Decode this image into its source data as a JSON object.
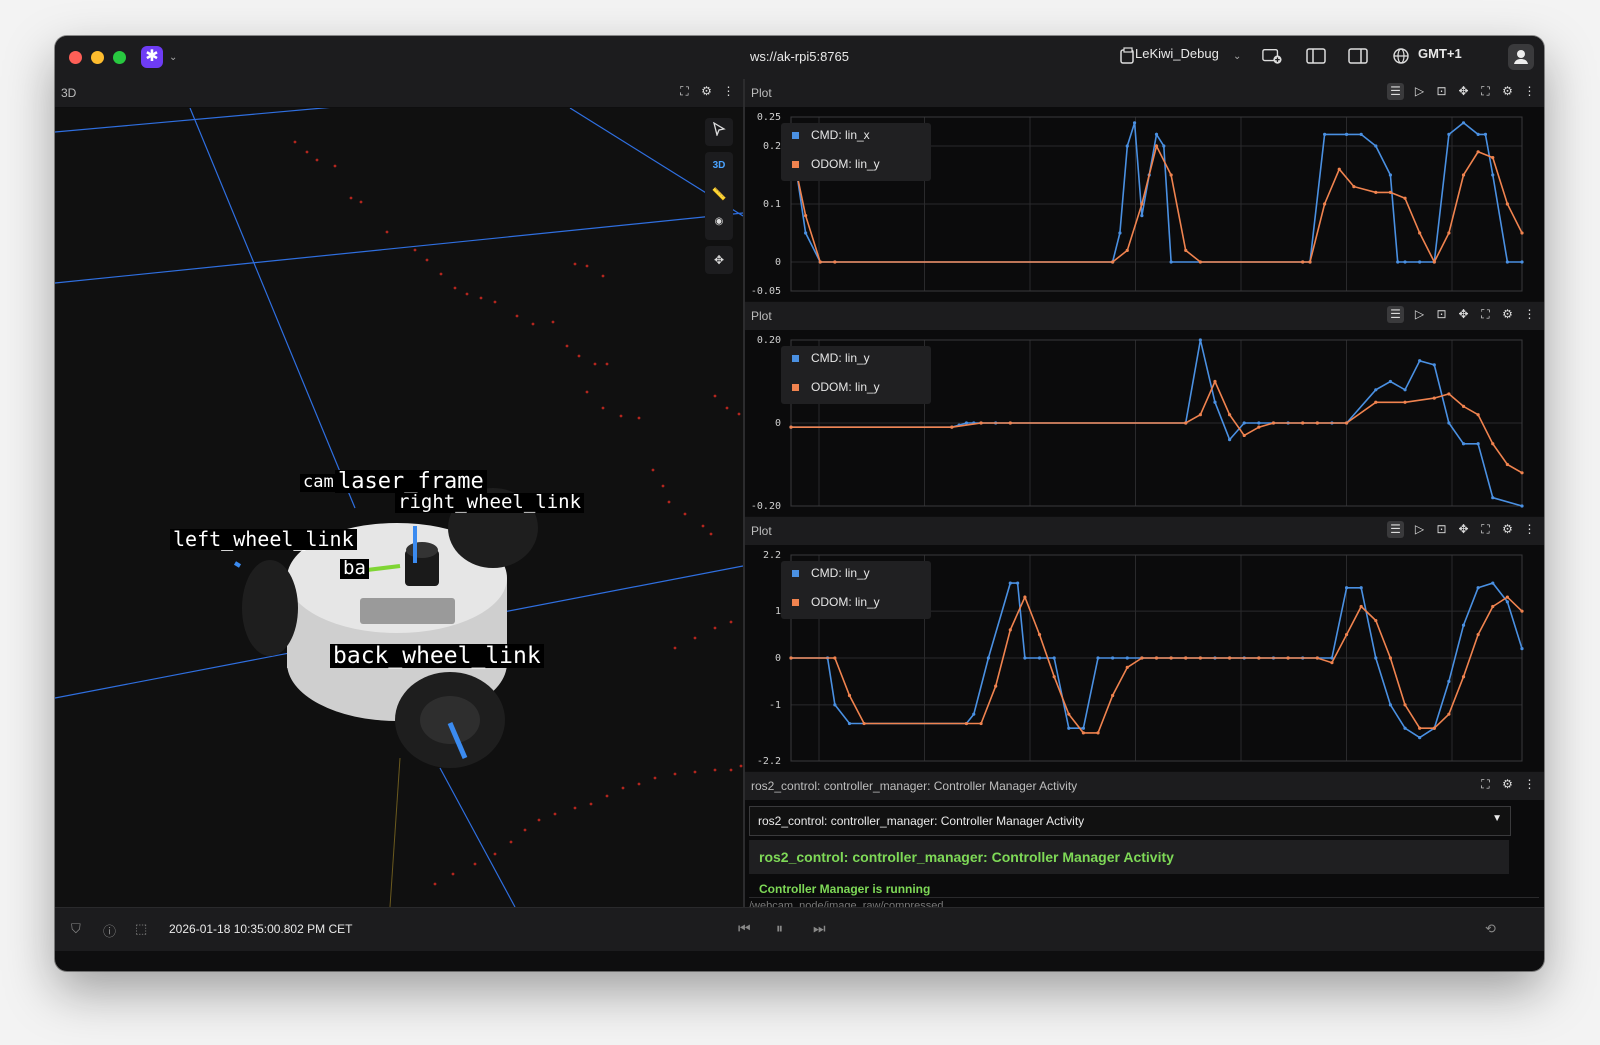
{
  "titlebar": {
    "connection": "ws://ak-rpi5:8765",
    "layout_name": "LeKiwi_Debug",
    "timezone": "GMT+1"
  },
  "panel3d": {
    "title": "3D",
    "mode_label": "3D",
    "frames": [
      "cam",
      "laser_frame",
      "right_wheel_link",
      "left_wheel_link",
      "ba",
      "back_wheel_link"
    ]
  },
  "plots": [
    {
      "title": "Plot",
      "legend": [
        "CMD: lin_x",
        "ODOM: lin_y"
      ],
      "yticks": [
        "0.25",
        "0.2",
        "0.1",
        "0",
        "-0.05"
      ],
      "ylim": [
        -0.05,
        0.25
      ]
    },
    {
      "title": "Plot",
      "legend": [
        "CMD: lin_y",
        "ODOM: lin_y"
      ],
      "yticks": [
        "0.20",
        "0",
        "-0.20"
      ],
      "ylim": [
        -0.2,
        0.2
      ]
    },
    {
      "title": "Plot",
      "legend": [
        "CMD: lin_y",
        "ODOM: lin_y"
      ],
      "yticks": [
        "2.2",
        "1",
        "0",
        "-1",
        "-2.2"
      ],
      "ylim": [
        -2.2,
        2.2
      ]
    }
  ],
  "colors": {
    "series_cmd": "#4a90e2",
    "series_odom": "#f0834f",
    "log_ok": "#7ed957",
    "accent": "#6e3cf5"
  },
  "chart_data": [
    {
      "type": "line",
      "ylim": [
        -0.05,
        0.25
      ],
      "series": [
        {
          "name": "CMD: lin_x",
          "x": [
            0,
            0.02,
            0.04,
            0.06,
            0.44,
            0.45,
            0.46,
            0.47,
            0.48,
            0.49,
            0.5,
            0.51,
            0.52,
            0.7,
            0.71,
            0.73,
            0.76,
            0.78,
            0.8,
            0.82,
            0.83,
            0.84,
            0.86,
            0.88,
            0.9,
            0.92,
            0.94,
            0.95,
            0.96,
            0.98,
            1.0
          ],
          "y": [
            0.22,
            0.05,
            0,
            0,
            0,
            0.05,
            0.2,
            0.24,
            0.08,
            0.15,
            0.22,
            0.2,
            0,
            0,
            0,
            0.22,
            0.22,
            0.22,
            0.2,
            0.15,
            0.0,
            0,
            0,
            0,
            0.22,
            0.24,
            0.22,
            0.22,
            0.15,
            0.0,
            0
          ]
        },
        {
          "name": "ODOM: lin_y",
          "x": [
            0,
            0.02,
            0.04,
            0.06,
            0.44,
            0.46,
            0.48,
            0.5,
            0.52,
            0.54,
            0.56,
            0.7,
            0.71,
            0.73,
            0.75,
            0.77,
            0.8,
            0.82,
            0.84,
            0.86,
            0.88,
            0.9,
            0.92,
            0.94,
            0.96,
            0.98,
            1.0
          ],
          "y": [
            0.2,
            0.08,
            0,
            0,
            0,
            0.02,
            0.1,
            0.2,
            0.15,
            0.02,
            0,
            0,
            0,
            0.1,
            0.16,
            0.13,
            0.12,
            0.12,
            0.11,
            0.05,
            0,
            0.05,
            0.15,
            0.19,
            0.18,
            0.1,
            0.05
          ]
        }
      ]
    },
    {
      "type": "line",
      "ylim": [
        -0.2,
        0.2
      ],
      "series": [
        {
          "name": "CMD: lin_y",
          "x": [
            0,
            0.22,
            0.23,
            0.24,
            0.25,
            0.26,
            0.28,
            0.3,
            0.54,
            0.56,
            0.58,
            0.6,
            0.62,
            0.64,
            0.66,
            0.68,
            0.7,
            0.72,
            0.74,
            0.76,
            0.8,
            0.82,
            0.84,
            0.86,
            0.88,
            0.9,
            0.92,
            0.94,
            0.96,
            1.0
          ],
          "y": [
            -0.01,
            -0.01,
            -0.005,
            0,
            0,
            0,
            0,
            0,
            0,
            0.2,
            0.05,
            -0.04,
            0,
            0,
            0,
            0,
            0,
            0,
            0,
            0,
            0.08,
            0.1,
            0.08,
            0.15,
            0.14,
            0.0,
            -0.05,
            -0.05,
            -0.18,
            -0.2
          ]
        },
        {
          "name": "ODOM: lin_y",
          "x": [
            0,
            0.22,
            0.26,
            0.3,
            0.54,
            0.56,
            0.58,
            0.6,
            0.62,
            0.64,
            0.66,
            0.7,
            0.72,
            0.76,
            0.8,
            0.84,
            0.88,
            0.9,
            0.92,
            0.94,
            0.96,
            0.98,
            1.0
          ],
          "y": [
            -0.01,
            -0.01,
            0,
            0,
            0,
            0.02,
            0.1,
            0.02,
            -0.03,
            -0.01,
            0,
            0,
            0,
            0,
            0.05,
            0.05,
            0.06,
            0.07,
            0.04,
            0.02,
            -0.05,
            -0.1,
            -0.12
          ]
        }
      ]
    },
    {
      "type": "line",
      "ylim": [
        -2.2,
        2.2
      ],
      "series": [
        {
          "name": "CMD: lin_y",
          "x": [
            0,
            0.05,
            0.06,
            0.08,
            0.24,
            0.25,
            0.27,
            0.3,
            0.31,
            0.32,
            0.34,
            0.36,
            0.38,
            0.4,
            0.42,
            0.44,
            0.46,
            0.48,
            0.5,
            0.52,
            0.54,
            0.56,
            0.58,
            0.6,
            0.62,
            0.64,
            0.66,
            0.68,
            0.7,
            0.72,
            0.74,
            0.76,
            0.78,
            0.8,
            0.82,
            0.84,
            0.86,
            0.88,
            0.9,
            0.92,
            0.94,
            0.96,
            0.98,
            1.0
          ],
          "y": [
            0,
            0,
            -1.0,
            -1.4,
            -1.4,
            -1.2,
            0,
            1.6,
            1.6,
            0,
            0,
            0,
            -1.5,
            -1.5,
            0,
            0,
            0,
            0,
            0,
            0,
            0,
            0,
            0,
            0,
            0,
            0,
            0,
            0,
            0,
            0,
            0,
            1.5,
            1.5,
            0,
            -1.0,
            -1.5,
            -1.7,
            -1.5,
            -0.5,
            0.7,
            1.5,
            1.6,
            1.2,
            0.2
          ]
        },
        {
          "name": "ODOM: lin_y",
          "x": [
            0,
            0.06,
            0.08,
            0.1,
            0.24,
            0.26,
            0.28,
            0.3,
            0.32,
            0.34,
            0.36,
            0.38,
            0.4,
            0.42,
            0.44,
            0.46,
            0.48,
            0.5,
            0.52,
            0.54,
            0.56,
            0.6,
            0.64,
            0.68,
            0.72,
            0.74,
            0.76,
            0.78,
            0.8,
            0.82,
            0.84,
            0.86,
            0.88,
            0.9,
            0.92,
            0.94,
            0.96,
            0.98,
            1.0
          ],
          "y": [
            0,
            0,
            -0.8,
            -1.4,
            -1.4,
            -1.4,
            -0.6,
            0.6,
            1.3,
            0.5,
            -0.4,
            -1.2,
            -1.6,
            -1.6,
            -0.8,
            -0.2,
            0,
            0,
            0,
            0,
            0,
            0,
            0,
            0,
            0,
            -0.1,
            0.5,
            1.1,
            0.8,
            0,
            -1.0,
            -1.5,
            -1.5,
            -1.2,
            -0.4,
            0.5,
            1.1,
            1.3,
            1.0
          ]
        }
      ]
    }
  ],
  "log": {
    "panel_title": "ros2_control: controller_manager: Controller Manager Activity",
    "select_value": "ros2_control: controller_manager: Controller Manager Activity",
    "entry_title": "ros2_control: controller_manager: Controller Manager Activity",
    "entry_line": "Controller Manager is running",
    "next_panel_title": "/webcam_node/image_raw/compressed"
  },
  "statusbar": {
    "timestamp": "2026-01-18 10:35:00.802 PM CET"
  }
}
